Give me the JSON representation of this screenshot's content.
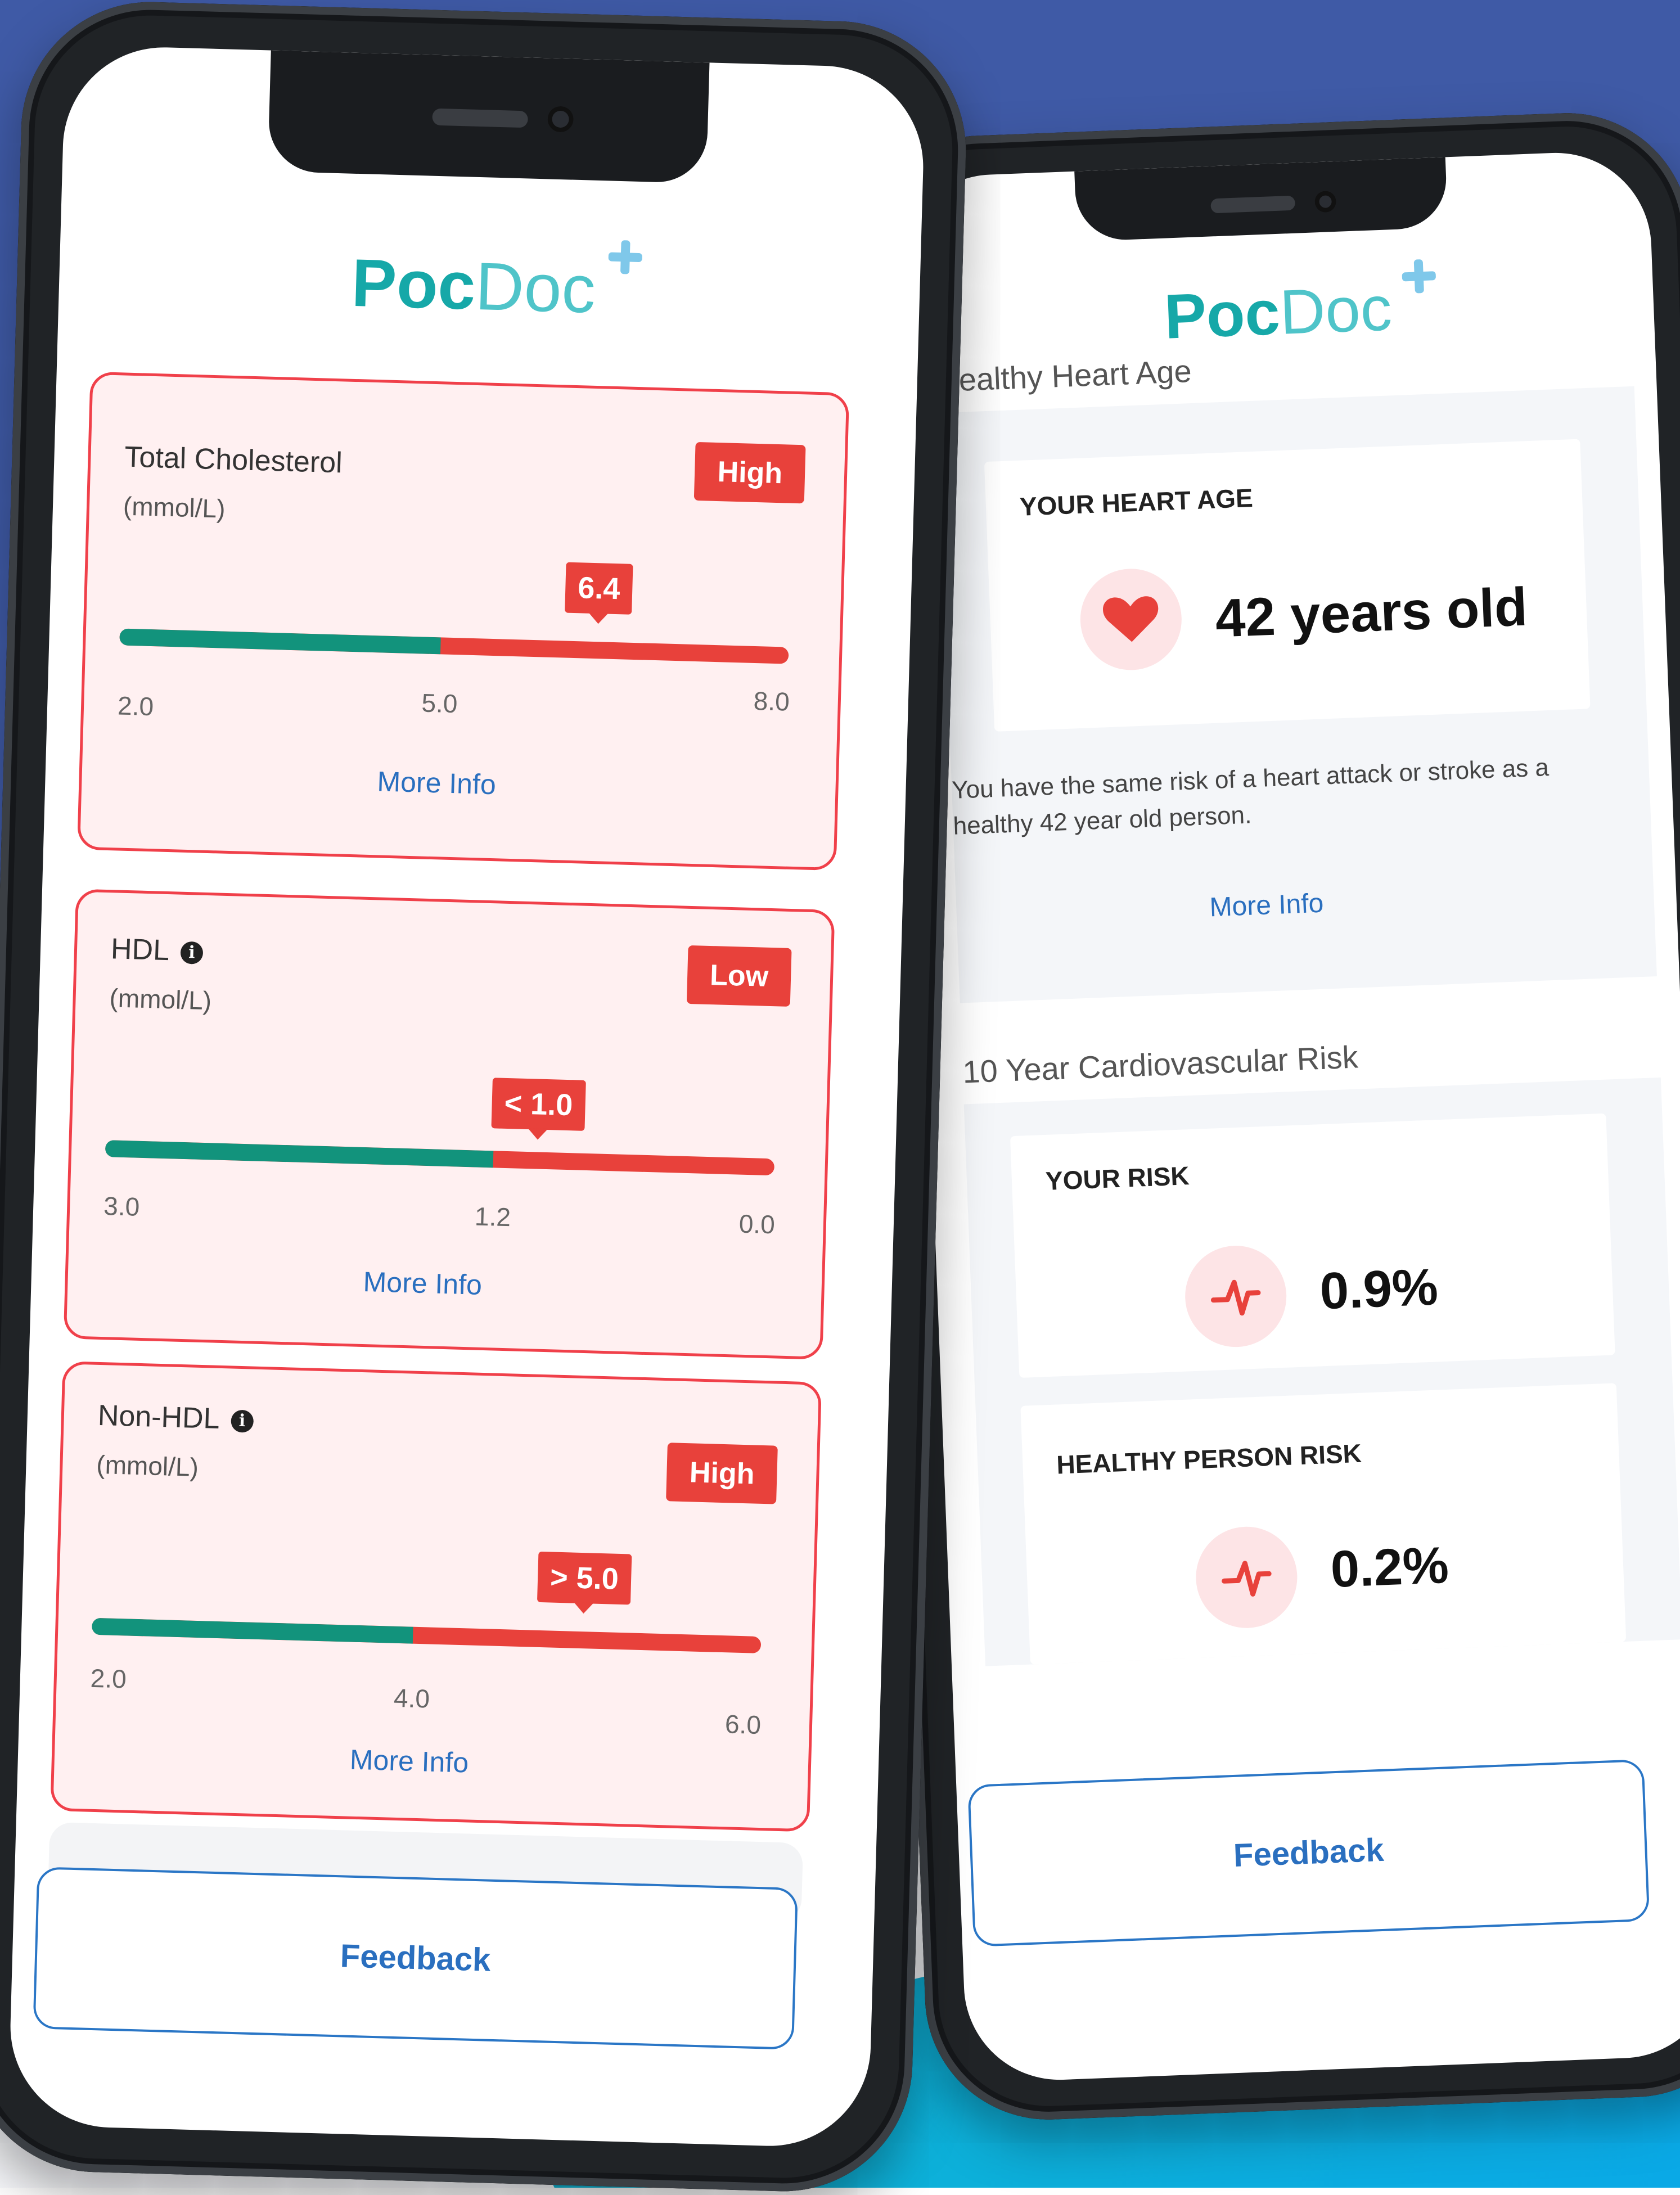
{
  "brand": {
    "bold": "Poc",
    "light": "Doc"
  },
  "left_screen": {
    "cards": [
      {
        "title": "Total Cholesterol",
        "unit": "(mmol/L)",
        "status": "High",
        "value": "6.4",
        "ticks": [
          "2.0",
          "5.0",
          "8.0"
        ],
        "more": "More Info",
        "green_fraction": 0.48,
        "marker_fraction": 0.72
      },
      {
        "title": "HDL",
        "unit": "(mmol/L)",
        "status": "Low",
        "value": "< 1.0",
        "ticks": [
          "3.0",
          "1.2",
          "0.0"
        ],
        "more": "More Info",
        "green_fraction": 0.58,
        "marker_fraction": 0.65
      },
      {
        "title": "Non-HDL",
        "unit": "(mmol/L)",
        "status": "High",
        "value": "> 5.0",
        "ticks": [
          "2.0",
          "4.0",
          "6.0"
        ],
        "more": "More Info",
        "green_fraction": 0.48,
        "marker_fraction": 0.73
      }
    ],
    "feedback": "Feedback"
  },
  "right_screen": {
    "heart_section_title": "Healthy Heart Age",
    "heart_label": "YOUR HEART AGE",
    "heart_value": "42 years old",
    "heart_desc": "You have the same risk of a heart attack or stroke as a healthy 42 year old person.",
    "heart_more": "More Info",
    "risk_section_title": "10 Year Cardiovascular Risk",
    "your_risk_label": "YOUR RISK",
    "your_risk_value": "0.9%",
    "healthy_risk_label": "HEALTHY PERSON RISK",
    "healthy_risk_value": "0.2%",
    "feedback": "Feedback"
  },
  "colors": {
    "accent_red": "#e8413b",
    "green": "#12937c",
    "link_blue": "#2a6fbf",
    "brand_teal": "#16a8a8"
  }
}
